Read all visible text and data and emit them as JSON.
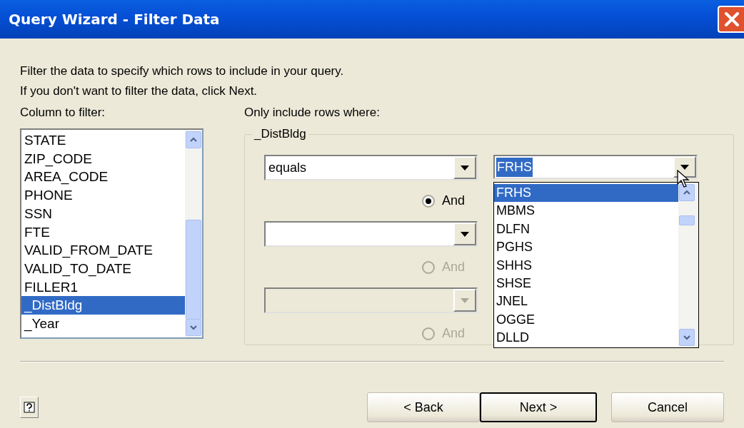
{
  "window": {
    "title": "Query Wizard - Filter Data"
  },
  "instructions": [
    "Filter the data to specify which rows to include in your query.",
    "If you don't want to filter the data, click Next."
  ],
  "column_list": {
    "label": "Column to filter:",
    "items": [
      {
        "text": "STATE",
        "selected": false
      },
      {
        "text": "ZIP_CODE",
        "selected": false
      },
      {
        "text": "AREA_CODE",
        "selected": false
      },
      {
        "text": "PHONE",
        "selected": false
      },
      {
        "text": "SSN",
        "selected": false
      },
      {
        "text": "FTE",
        "selected": false
      },
      {
        "text": "VALID_FROM_DATE",
        "selected": false
      },
      {
        "text": "VALID_TO_DATE",
        "selected": false
      },
      {
        "text": "FILLER1",
        "selected": false
      },
      {
        "text": "_DistBldg",
        "selected": true
      },
      {
        "text": "_Year",
        "selected": false
      }
    ]
  },
  "criteria": {
    "label": "Only include rows where:",
    "group_title": "_DistBldg",
    "rows": [
      {
        "operator": "equals",
        "disabled": false,
        "connector": {
          "label": "And",
          "checked": true,
          "disabled": false
        }
      },
      {
        "disabled": false,
        "connector": {
          "label": "And",
          "checked": false,
          "disabled": true
        }
      },
      {
        "disabled": true,
        "connector": {
          "label": "And",
          "checked": false,
          "disabled": true
        }
      }
    ]
  },
  "value_combo": {
    "value": "FRHS",
    "text_selected": true
  },
  "dropdown": {
    "items": [
      {
        "text": "FRHS",
        "selected": true
      },
      {
        "text": "MBMS",
        "selected": false
      },
      {
        "text": "DLFN",
        "selected": false
      },
      {
        "text": "PGHS",
        "selected": false
      },
      {
        "text": "SHHS",
        "selected": false
      },
      {
        "text": "SHSE",
        "selected": false
      },
      {
        "text": "JNEL",
        "selected": false
      },
      {
        "text": "OGGE",
        "selected": false
      },
      {
        "text": "DLLD",
        "selected": false
      }
    ]
  },
  "buttons": [
    {
      "label": "< Back",
      "default": false
    },
    {
      "label": "Next >",
      "default": true
    },
    {
      "label": "Cancel",
      "default": false
    }
  ]
}
